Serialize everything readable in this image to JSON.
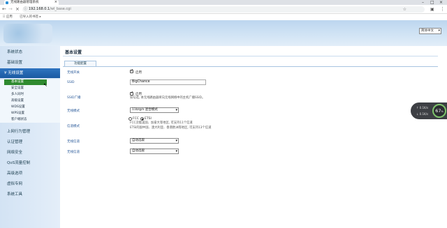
{
  "browser": {
    "tab_title": "无线路由器管理系统",
    "url_host": "192.168.0.1",
    "url_path": "/wl_base.cgi",
    "bookmarks_text": "应用　　 已导入的书签 ▸"
  },
  "header": {
    "lang": "简体中文"
  },
  "sidebar": {
    "items": [
      {
        "label": "系统状态"
      },
      {
        "label": "基础设置"
      },
      {
        "label": "无线设置"
      },
      {
        "label": "上网行为管理"
      },
      {
        "label": "认证管理"
      },
      {
        "label": "网络安全"
      },
      {
        "label": "QoS流量控制"
      },
      {
        "label": "高级选项"
      },
      {
        "label": "虚拟专网"
      },
      {
        "label": "系统工具"
      }
    ],
    "subitems": [
      {
        "label": "基本设置"
      },
      {
        "label": "安全设置"
      },
      {
        "label": "多人同时"
      },
      {
        "label": "高级设置"
      },
      {
        "label": "WDS设置"
      },
      {
        "label": "WPS设置"
      },
      {
        "label": "客户端状态"
      }
    ]
  },
  "main": {
    "title": "基本设置",
    "tab": "功能配置",
    "rows": {
      "wireless_switch": {
        "label": "无线开关",
        "value": "启用"
      },
      "ssid": {
        "label": "SSID",
        "value": "BigChance"
      },
      "ssid_broadcast": {
        "label": "SSID广播",
        "value": "启用",
        "hint": "如勾选, 本无线路由器将向无线网络中的主机广播SSID。"
      },
      "wireless_mode": {
        "label": "无线模式",
        "value": "11b/g/n 混合模式"
      },
      "country": {
        "label": "信道模式",
        "options": [
          "FCC",
          "ETSI"
        ],
        "selected": "ETSI",
        "hint1": "FCC次能美国、加拿大等地区, 可支持11个信道",
        "hint2": "ETSI的国中国、澳大利亚、香港欧洲等地区, 可支持13个信道"
      },
      "channel": {
        "label": "无线信道",
        "value": "自动选取"
      },
      "bandwidth": {
        "label": "无线信道",
        "value": "自动选取"
      }
    }
  },
  "widget": {
    "up": "↑ 0.1K/s",
    "down": "↓ 0.1K/s",
    "percent": "67",
    "percent_sign": "%"
  }
}
